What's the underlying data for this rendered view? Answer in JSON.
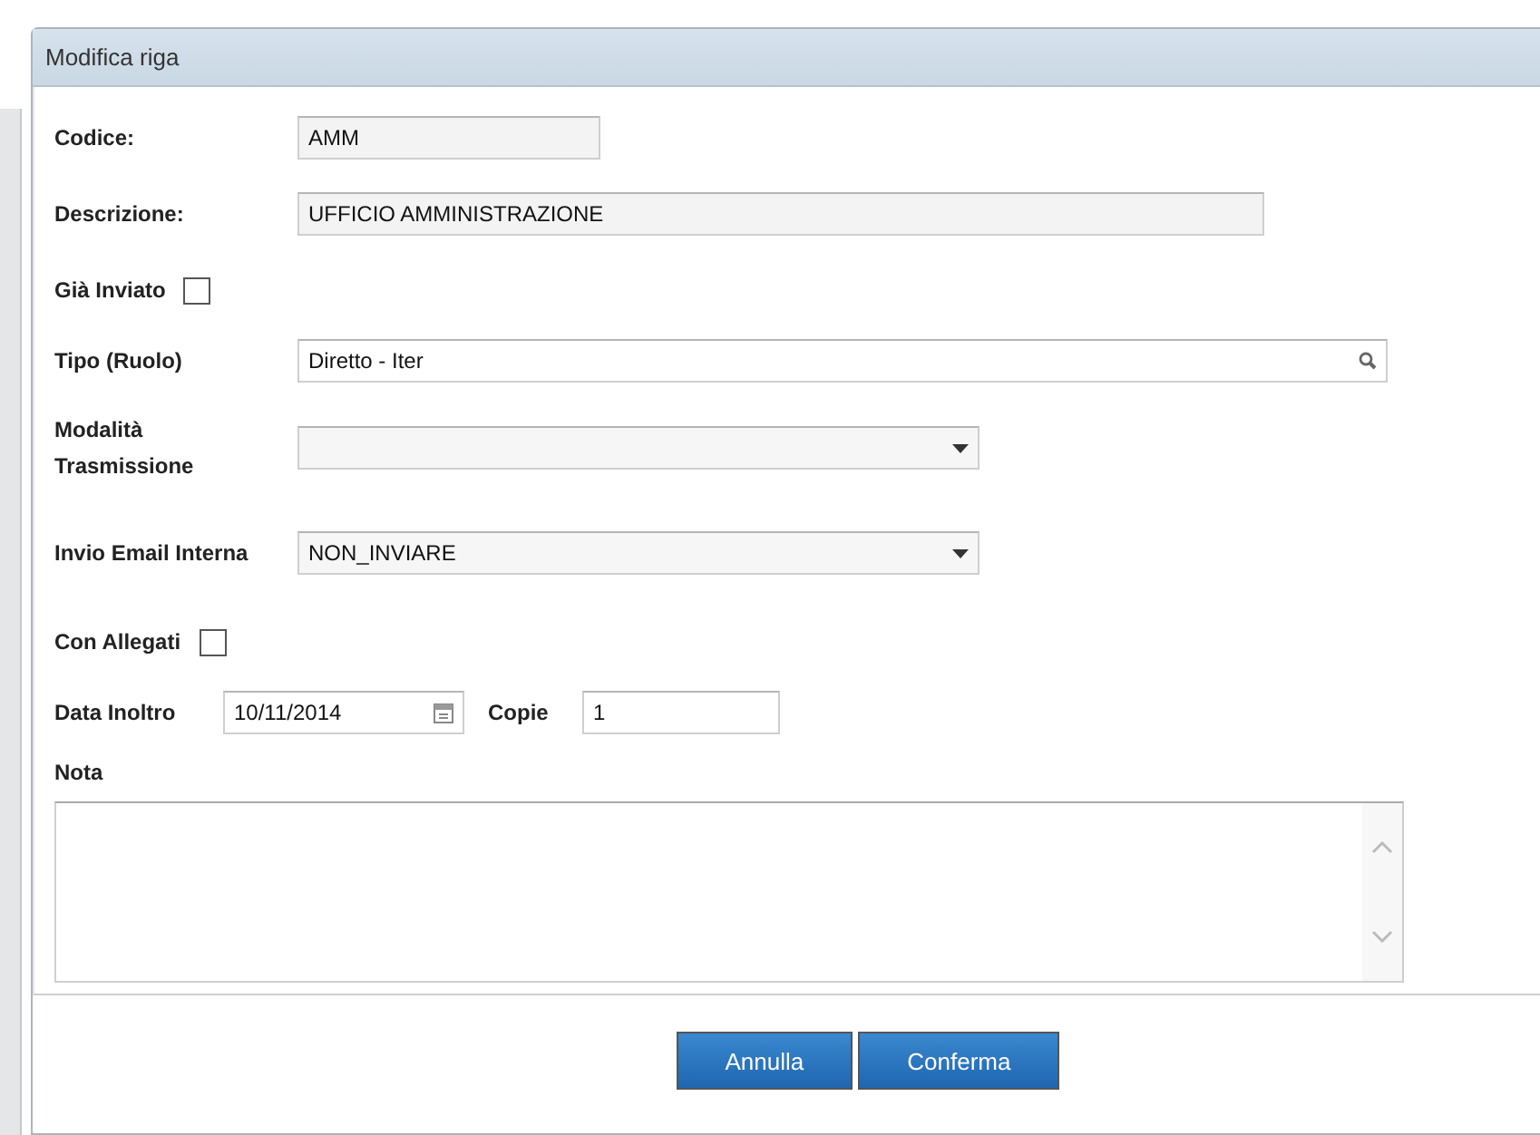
{
  "dialog": {
    "title": "Modifica riga"
  },
  "fields": [
    {
      "kind": "shorttext",
      "label": "Codice:",
      "value": "AMM"
    },
    {
      "kind": "text",
      "label": "Descrizione:",
      "value": "UFFICIO AMMINISTRAZIONE"
    },
    {
      "kind": "checkbox",
      "label": "Già Inviato",
      "checked": false
    },
    {
      "kind": "lookup",
      "label": "Tipo (Ruolo)",
      "value": "Diretto - Iter"
    },
    {
      "kind": "select",
      "label": "Modalità Trasmissione"
    },
    {
      "kind": "select",
      "label": "Invio Email Interna",
      "value": "NON_INVIARE"
    },
    {
      "kind": "checkbox",
      "label": "Con Allegati",
      "checked": false
    },
    {
      "kind": "dateCopies",
      "label": "Data Inoltro",
      "value": "10/11/2014",
      "copies_label": "Copie",
      "copies_value": "1"
    },
    {
      "kind": "textarea",
      "label": "Nota"
    }
  ],
  "buttons": [
    "Annulla",
    "Conferma"
  ]
}
